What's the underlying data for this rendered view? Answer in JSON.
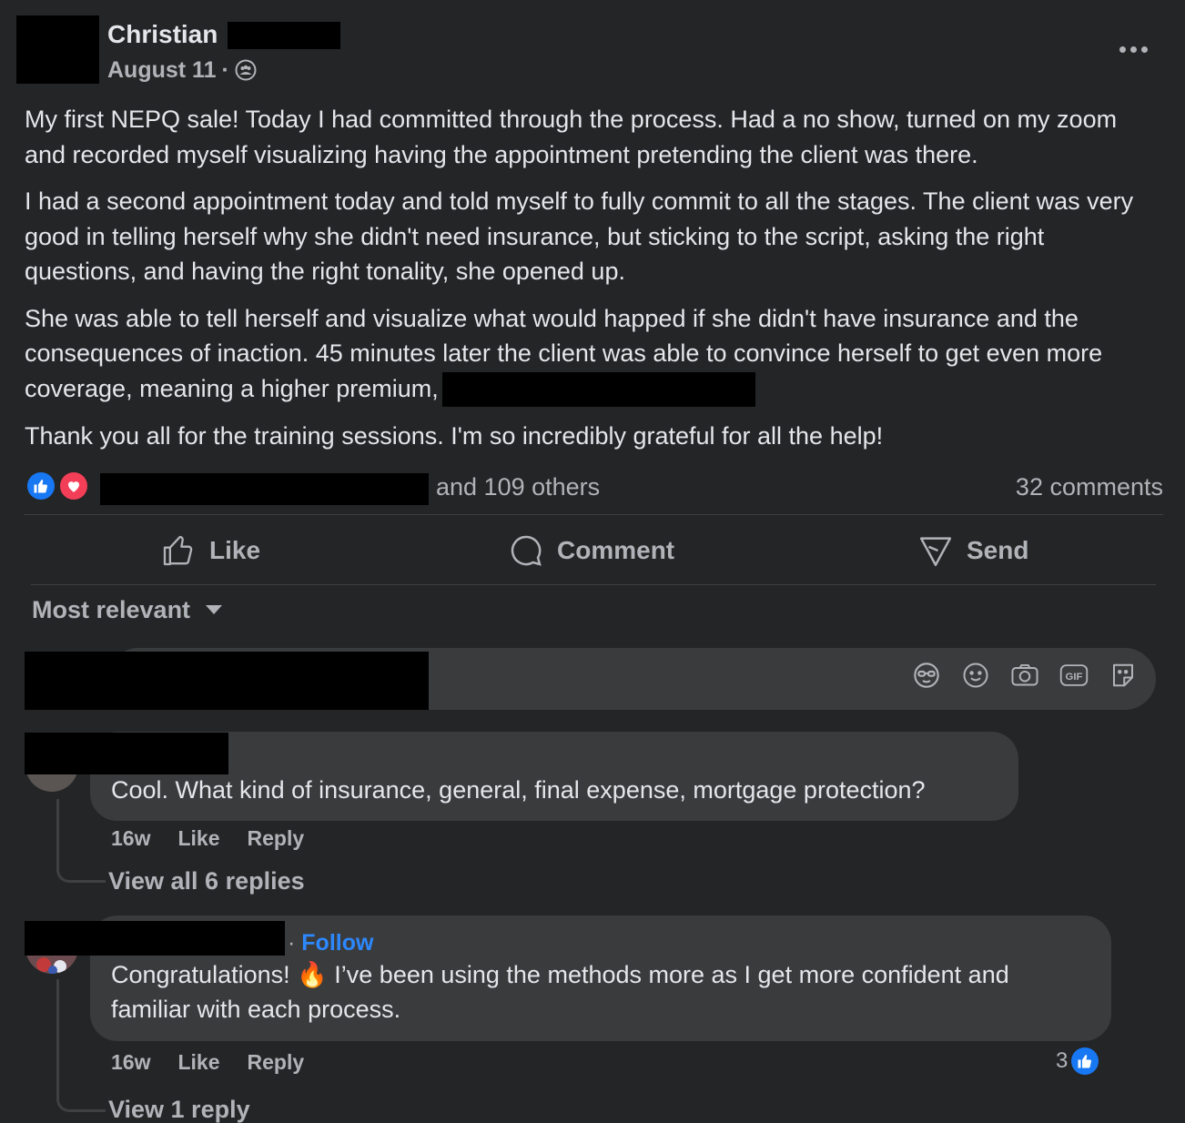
{
  "post": {
    "author": "Christian",
    "date": "August 11",
    "separator": "·",
    "privacy_icon": "group-icon",
    "more_icon": "more-horizontal-icon",
    "paragraphs": [
      "My first NEPQ sale! Today I had committed through the process. Had a no show, turned on my zoom and recorded myself visualizing having the appointment pretending the client was there.",
      "I had a second appointment today and told myself to fully commit to all the stages. The client was very good in telling herself why she didn't need insurance, but sticking to the script, asking the right questions, and having the right tonality, she opened up.",
      "She was able to tell herself and visualize what would happed if she didn't have insurance and the consequences of inaction. 45 minutes later the client was able to convince herself to get even more coverage, meaning a higher premium,",
      "Thank you all for the training sessions. I'm so incredibly grateful for all the help!"
    ]
  },
  "reactions": {
    "others": "and 109 others",
    "comments": "32 comments",
    "colors": {
      "like": "#1877f2",
      "love": "#f33e58"
    }
  },
  "actions": {
    "like": "Like",
    "comment": "Comment",
    "send": "Send"
  },
  "sort": {
    "label": "Most relevant"
  },
  "composer": {
    "icons": [
      "avatar-sticker-icon",
      "emoji-icon",
      "camera-icon",
      "gif-icon",
      "sticker-icon"
    ],
    "gif_text": "GIF"
  },
  "comments": [
    {
      "text": "Cool. What kind of insurance, general, final expense, mortgage protection?",
      "time": "16w",
      "like": "Like",
      "reply": "Reply",
      "view_replies": "View all 6 replies"
    },
    {
      "follow": "Follow",
      "follow_sep": "·",
      "text_before": "Congratulations!",
      "emoji": "🔥",
      "text_after": "I’ve been using the methods more as I get more confident and familiar with each process.",
      "time": "16w",
      "like": "Like",
      "reply": "Reply",
      "like_count": "3",
      "view_replies": "View 1 reply"
    }
  ]
}
